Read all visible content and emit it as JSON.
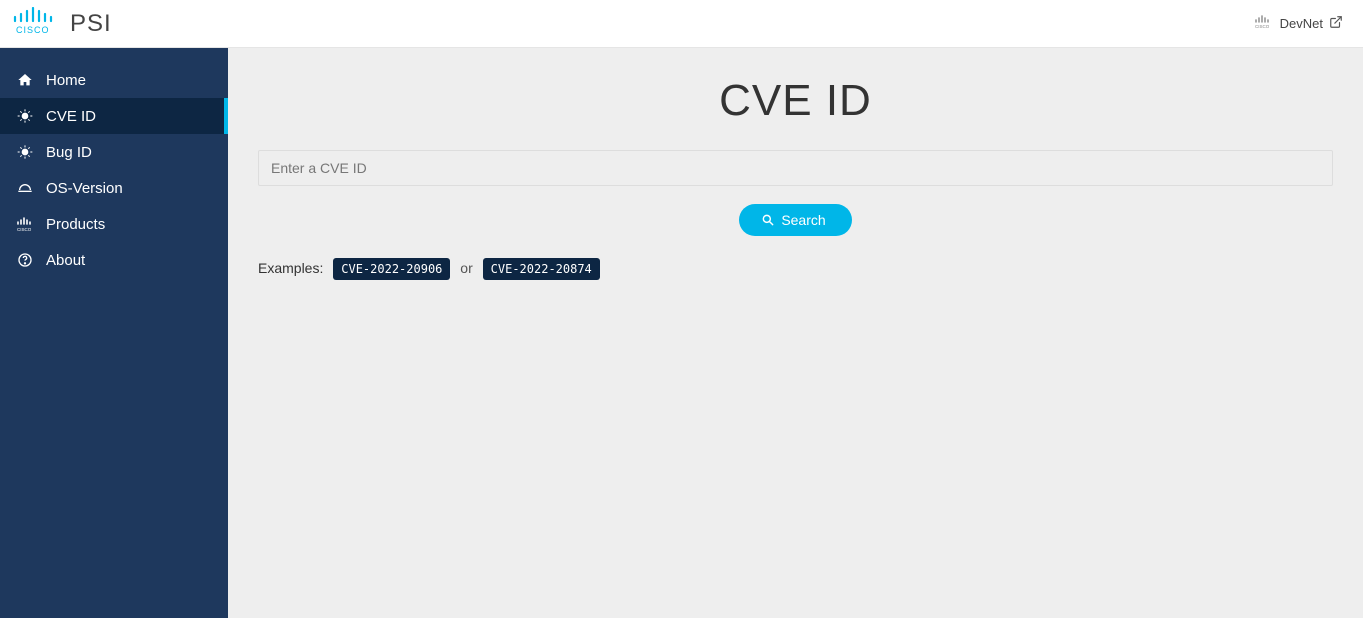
{
  "header": {
    "app_name": "PSI",
    "devnet_label": "DevNet"
  },
  "sidebar": {
    "items": [
      {
        "label": "Home",
        "icon": "home"
      },
      {
        "label": "CVE ID",
        "icon": "bug",
        "active": true
      },
      {
        "label": "Bug ID",
        "icon": "bug"
      },
      {
        "label": "OS-Version",
        "icon": "helmet"
      },
      {
        "label": "Products",
        "icon": "cisco"
      },
      {
        "label": "About",
        "icon": "question"
      }
    ]
  },
  "main": {
    "title": "CVE ID",
    "search": {
      "placeholder": "Enter a CVE ID",
      "button_label": "Search"
    },
    "examples": {
      "label": "Examples:",
      "items": [
        "CVE-2022-20906",
        "CVE-2022-20874"
      ],
      "separator": "or"
    }
  }
}
